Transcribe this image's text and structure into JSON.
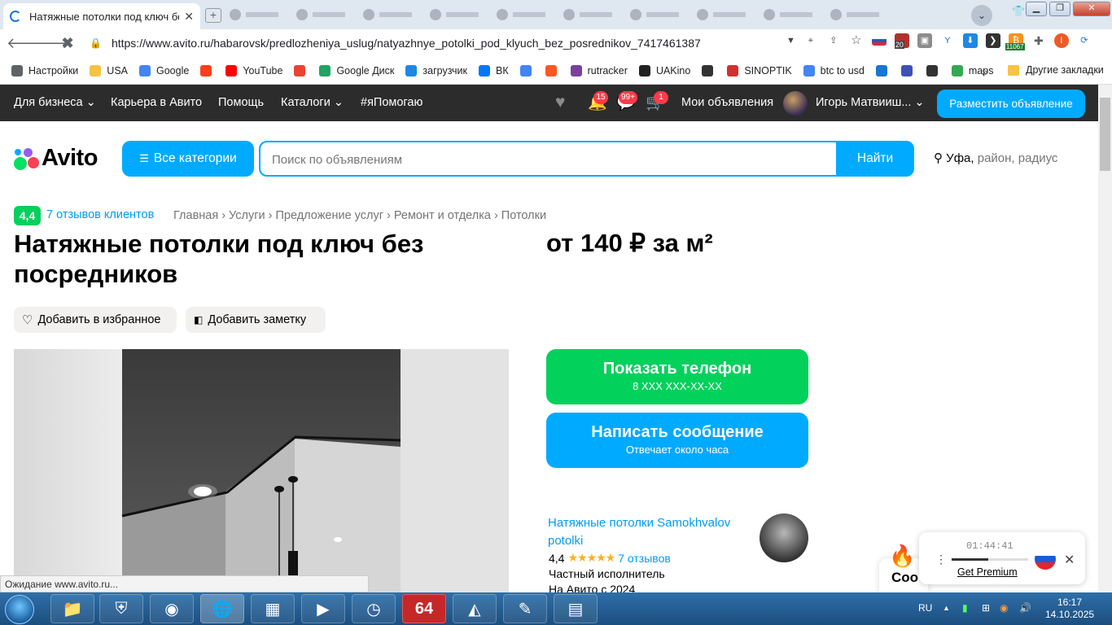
{
  "browser": {
    "tab_title": "Натяжные потолки под ключ без",
    "tab_close": "✕",
    "new_tab": "+",
    "url": "https://www.avito.ru/habarovsk/predlozheniya_uslug/natyazhnye_potolki_pod_klyuch_bez_posrednikov_7417461387",
    "status_text": "Ожидание www.avito.ru...",
    "ext_badge_20": "20",
    "ext_badge_11067": "11067",
    "profile_initial": "I",
    "bookmarks": [
      {
        "label": "Настройки",
        "icon": "gear-icon",
        "color": "#5f6368"
      },
      {
        "label": "USA",
        "icon": "folder-icon",
        "color": "#f6c343"
      },
      {
        "label": "Google",
        "icon": "google-icon",
        "color": "#4285f4"
      },
      {
        "label": "",
        "icon": "yandex-icon",
        "color": "#fc3f1d"
      },
      {
        "label": "YouTube",
        "icon": "youtube-icon",
        "color": "#ff0000"
      },
      {
        "label": "",
        "icon": "gmail-icon",
        "color": "#ea4335"
      },
      {
        "label": "Google Диск",
        "icon": "drive-icon",
        "color": "#1fa463"
      },
      {
        "label": "загрузчик",
        "icon": "infinity-icon",
        "color": "#1e88e5"
      },
      {
        "label": "ВК",
        "icon": "vk-icon",
        "color": "#0077ff"
      },
      {
        "label": "",
        "icon": "translate-icon",
        "color": "#4285f4"
      },
      {
        "label": "",
        "icon": "f-icon",
        "color": "#ff5722"
      },
      {
        "label": "rutracker",
        "icon": "rutracker-icon",
        "color": "#7b3fa0"
      },
      {
        "label": "UAKino",
        "icon": "uakino-icon",
        "color": "#222222"
      },
      {
        "label": "",
        "icon": "chess-icon",
        "color": "#333333"
      },
      {
        "label": "SINOPTIK",
        "icon": "thermometer-icon",
        "color": "#d32f2f"
      },
      {
        "label": "btc to usd",
        "icon": "google-icon",
        "color": "#4285f4"
      },
      {
        "label": "",
        "icon": "p-icon",
        "color": "#1976d2"
      },
      {
        "label": "",
        "icon": "chevron-left-icon",
        "color": "#3f51b5"
      },
      {
        "label": "",
        "icon": "bc-icon",
        "color": "#333333"
      },
      {
        "label": "maps",
        "icon": "maps-icon",
        "color": "#34a853"
      }
    ],
    "bookmarks_more": "»",
    "other_bookmarks": "Другие закладки"
  },
  "avito": {
    "nav": {
      "business": "Для бизнеса",
      "career": "Карьера в Авито",
      "help": "Помощь",
      "catalogs": "Каталоги",
      "help_hashtag": "#яПомогаю",
      "my_ads": "Мои объявления",
      "user_name": "Игорь Матвииш...",
      "place_ad": "Разместить объявление",
      "badges": {
        "notifications": "15",
        "messages": "99+",
        "cart": "1"
      }
    },
    "logo_text": "Avito",
    "categories_button": "Все категории",
    "search": {
      "placeholder": "Поиск по объявлениям",
      "value": "",
      "button": "Найти"
    },
    "location": {
      "city": "Уфа,",
      "rest": "район, радиус"
    },
    "listing": {
      "rating": "4,4",
      "reviews_link": "7 отзывов клиентов",
      "breadcrumbs": [
        "Главная",
        "Услуги",
        "Предложение услуг",
        "Ремонт и отделка",
        "Потолки"
      ],
      "breadcrumb_sep": "›",
      "title": "Натяжные потолки под ключ без посредников",
      "price": "от 140 ₽ за м²",
      "add_favorite": "Добавить в избранное",
      "add_note": "Добавить заметку",
      "show_phone": "Показать телефон",
      "phone_mask": "8 XXX XXX-XX-XX",
      "write_message": "Написать сообщение",
      "reply_time": "Отвечает около часа"
    },
    "seller": {
      "name": "Натяжные потолки Samokhvalov potolki",
      "rating": "4,4",
      "stars_filled": 4.5,
      "stars_text": "★★★★★",
      "reviews": "7 отзывов",
      "type": "Частный исполнитель",
      "since": "На Авито с 2024"
    },
    "fab_partial_text": "Соо"
  },
  "player": {
    "time": "01:44:41",
    "progress": 0.48,
    "premium": "Get Premium",
    "close": "✕",
    "menu": "⋮"
  },
  "taskbar": {
    "language": "RU",
    "time": "16:17",
    "date": "14.10.2025",
    "app_64": "64"
  },
  "colors": {
    "avito_blue": "#00aaff",
    "avito_green": "#02d15c",
    "link_blue": "#009cf0",
    "header_dark": "#2c2c2c",
    "badge_red": "#ff3b4a"
  }
}
